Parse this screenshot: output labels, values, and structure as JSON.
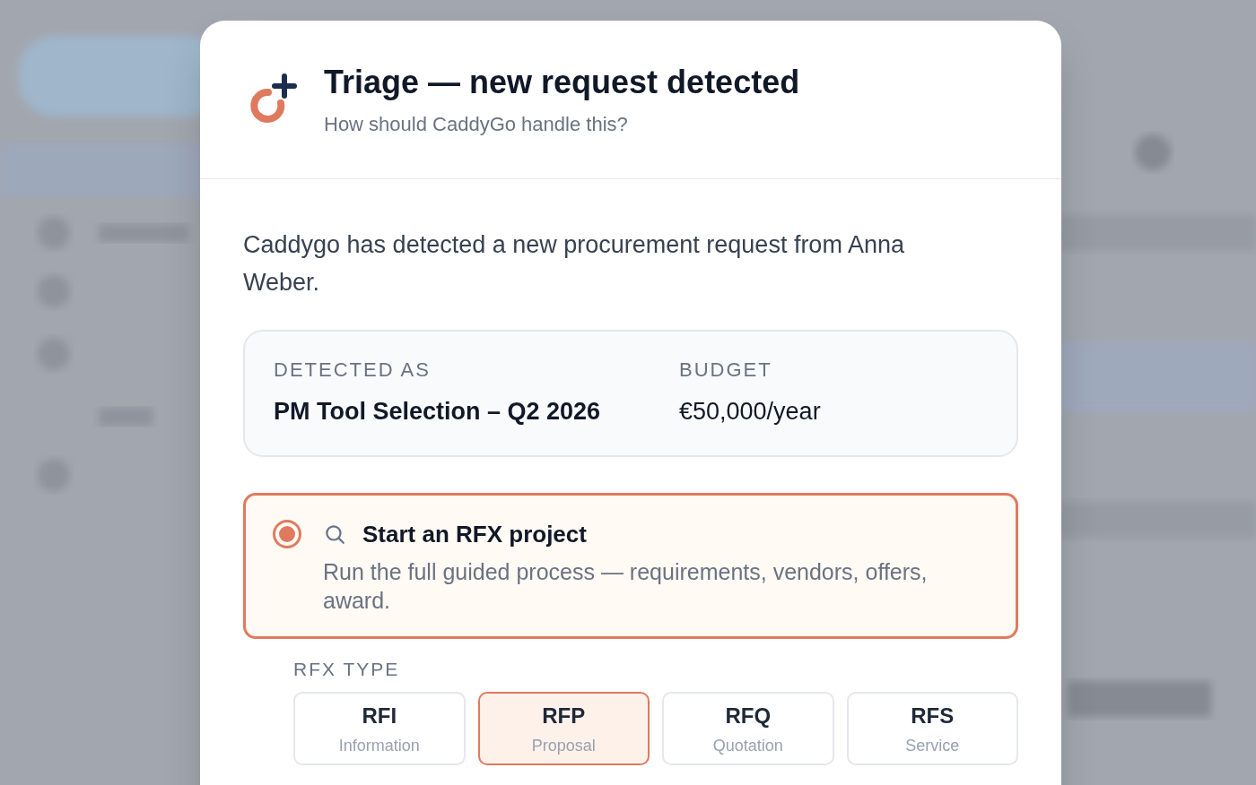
{
  "dialog": {
    "title": "Triage — new request detected",
    "subtitle": "How should CaddyGo handle this?"
  },
  "message": "Caddygo has detected a new procurement request from Anna Weber.",
  "detected": [
    {
      "label": "DETECTED AS",
      "value": "PM Tool Selection – Q2 2026",
      "bold": true
    },
    {
      "label": "BUDGET",
      "value": "€50,000/year",
      "bold": false
    }
  ],
  "options": [
    {
      "title": "Start an RFX project",
      "description": "Run the full guided process — requirements, vendors, offers, award.",
      "selected": true
    }
  ],
  "rfx_type": {
    "label": "RFX TYPE",
    "types": [
      {
        "code": "RFI",
        "name": "Information",
        "selected": false
      },
      {
        "code": "RFP",
        "name": "Proposal",
        "selected": true
      },
      {
        "code": "RFQ",
        "name": "Quotation",
        "selected": false
      },
      {
        "code": "RFS",
        "name": "Service",
        "selected": false
      }
    ]
  }
}
